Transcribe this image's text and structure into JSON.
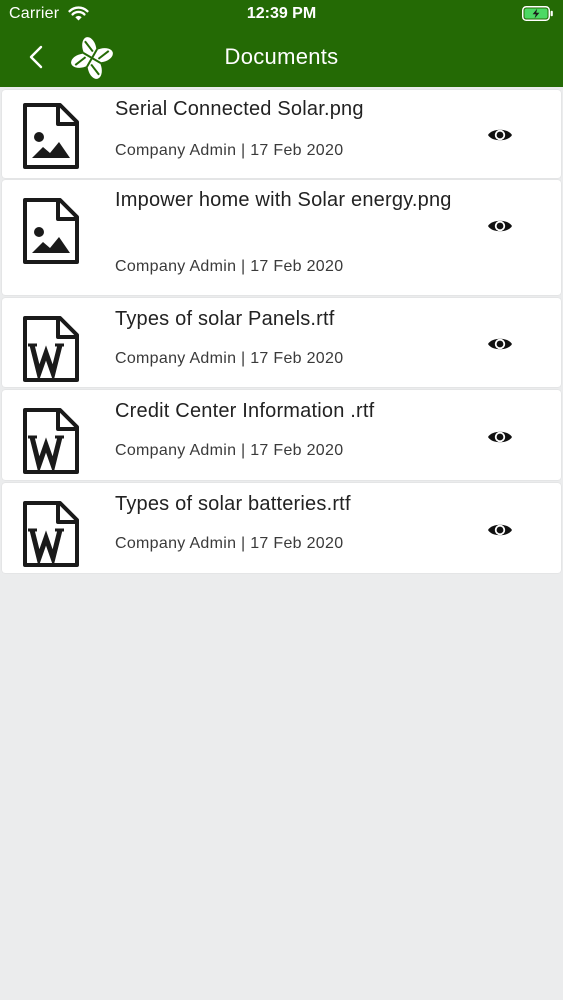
{
  "status_bar": {
    "carrier": "Carrier",
    "time": "12:39 PM"
  },
  "nav": {
    "title": "Documents",
    "back_icon": "chevron-left-icon",
    "logo_icon": "clover-logo-icon"
  },
  "colors": {
    "header": "#246a05",
    "background": "#ebeced",
    "card": "#ffffff",
    "text": "#222222",
    "battery": "#4cd964"
  },
  "documents": [
    {
      "name": "Serial Connected Solar.png",
      "meta": "Company Admin | 17 Feb 2020",
      "type_icon": "image-file-icon",
      "action_icon": "eye-icon"
    },
    {
      "name": "Impower home with Solar energy.png",
      "meta": "Company Admin | 17 Feb 2020",
      "type_icon": "image-file-icon",
      "action_icon": "eye-icon"
    },
    {
      "name": "Types of solar Panels.rtf",
      "meta": "Company Admin | 17 Feb 2020",
      "type_icon": "word-file-icon",
      "action_icon": "eye-icon"
    },
    {
      "name": "Credit Center Information .rtf",
      "meta": "Company Admin | 17 Feb 2020",
      "type_icon": "word-file-icon",
      "action_icon": "eye-icon"
    },
    {
      "name": "Types of solar batteries.rtf",
      "meta": "Company Admin | 17 Feb 2020",
      "type_icon": "word-file-icon",
      "action_icon": "eye-icon"
    }
  ]
}
